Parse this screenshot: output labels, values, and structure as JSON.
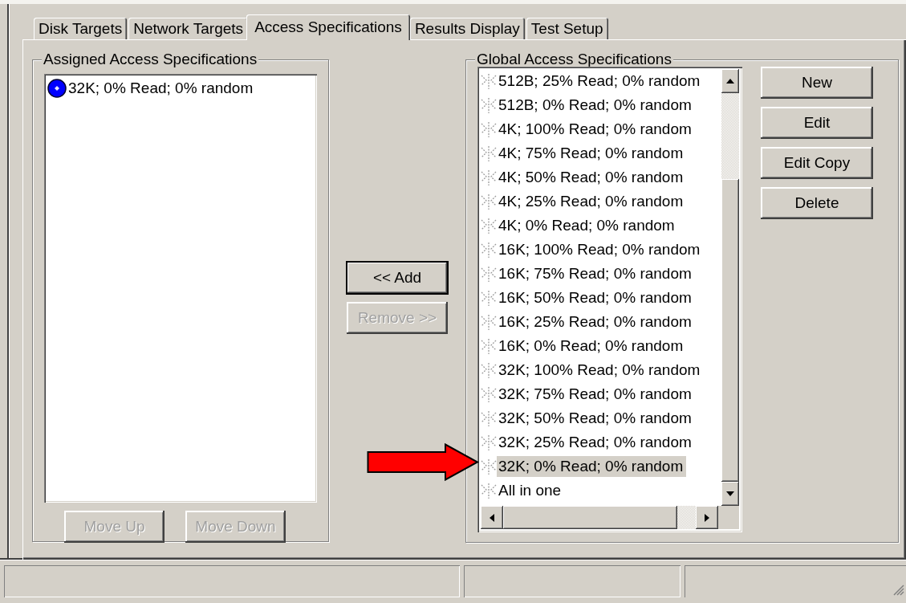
{
  "tabs": [
    {
      "label": "Disk Targets",
      "selected": false
    },
    {
      "label": "Network Targets",
      "selected": false
    },
    {
      "label": "Access Specifications",
      "selected": true
    },
    {
      "label": "Results Display",
      "selected": false
    },
    {
      "label": "Test Setup",
      "selected": false
    }
  ],
  "assigned": {
    "title": "Assigned Access Specifications",
    "items": [
      {
        "label": "32K; 0% Read; 0% random",
        "selected": false
      }
    ],
    "buttons": [
      {
        "label": "Move Up",
        "disabled": true
      },
      {
        "label": "Move Down",
        "disabled": true
      }
    ]
  },
  "middle_buttons": [
    {
      "label": "<< Add",
      "disabled": false
    },
    {
      "label": "Remove >>",
      "disabled": true
    }
  ],
  "global": {
    "title": "Global Access Specifications",
    "items": [
      {
        "label": "512B; 25% Read; 0% random",
        "selected": false
      },
      {
        "label": "512B; 0% Read; 0% random",
        "selected": false
      },
      {
        "label": "4K; 100% Read; 0% random",
        "selected": false
      },
      {
        "label": "4K; 75% Read; 0% random",
        "selected": false
      },
      {
        "label": "4K; 50% Read; 0% random",
        "selected": false
      },
      {
        "label": "4K; 25% Read; 0% random",
        "selected": false
      },
      {
        "label": "4K; 0% Read; 0% random",
        "selected": false
      },
      {
        "label": "16K; 100% Read; 0% random",
        "selected": false
      },
      {
        "label": "16K; 75% Read; 0% random",
        "selected": false
      },
      {
        "label": "16K; 50% Read; 0% random",
        "selected": false
      },
      {
        "label": "16K; 25% Read; 0% random",
        "selected": false
      },
      {
        "label": "16K; 0% Read; 0% random",
        "selected": false
      },
      {
        "label": "32K; 100% Read; 0% random",
        "selected": false
      },
      {
        "label": "32K; 75% Read; 0% random",
        "selected": false
      },
      {
        "label": "32K; 50% Read; 0% random",
        "selected": false
      },
      {
        "label": "32K; 25% Read; 0% random",
        "selected": false
      },
      {
        "label": "32K; 0% Read; 0% random",
        "selected": true
      },
      {
        "label": "All in one",
        "selected": false
      }
    ],
    "buttons": [
      {
        "label": "New",
        "disabled": false
      },
      {
        "label": "Edit",
        "disabled": false
      },
      {
        "label": "Edit Copy",
        "disabled": false
      },
      {
        "label": "Delete",
        "disabled": false
      }
    ]
  }
}
